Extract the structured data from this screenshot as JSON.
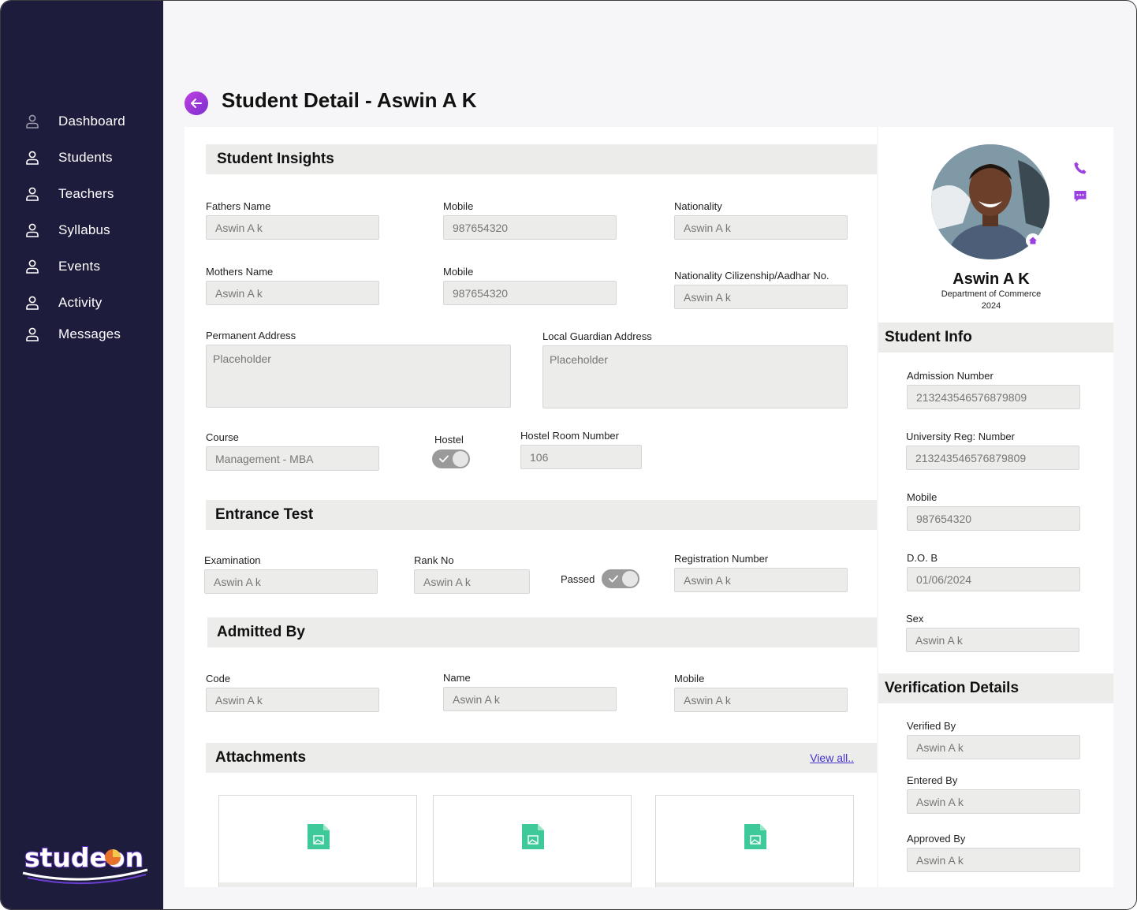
{
  "sidebar": {
    "items": [
      {
        "label": "Dashboard"
      },
      {
        "label": "Students"
      },
      {
        "label": "Teachers"
      },
      {
        "label": "Syllabus"
      },
      {
        "label": "Events"
      },
      {
        "label": "Activity"
      },
      {
        "label": "Messages"
      }
    ],
    "logo_text": "studeon"
  },
  "header": {
    "title": "Student Detail - Aswin A K"
  },
  "insights": {
    "title": "Student  Insights",
    "fathers_name": {
      "label": "Fathers Name",
      "value": "Aswin A k"
    },
    "fathers_mobile": {
      "label": "Mobile",
      "value": "987654320"
    },
    "nationality": {
      "label": "Nationality",
      "value": "Aswin A k"
    },
    "mothers_name": {
      "label": "Mothers Name",
      "value": "Aswin A k"
    },
    "mothers_mobile": {
      "label": "Mobile",
      "value": "987654320"
    },
    "citizenship": {
      "label": "Nationality Cilizenship/Aadhar No.",
      "value": "Aswin A k"
    },
    "permanent_address": {
      "label": "Permanent Address",
      "placeholder": "Placeholder"
    },
    "guardian_address": {
      "label": "Local Guardian Address",
      "placeholder": "Placeholder"
    },
    "course": {
      "label": "Course",
      "value": "Management - MBA"
    },
    "hostel": {
      "label": "Hostel",
      "on": true
    },
    "hostel_room": {
      "label": "Hostel Room Number",
      "value": "106"
    }
  },
  "entrance": {
    "title": "Entrance Test",
    "examination": {
      "label": "Examination",
      "value": "Aswin A k"
    },
    "rank": {
      "label": "Rank No",
      "value": "Aswin A k"
    },
    "passed": {
      "label": "Passed",
      "on": true
    },
    "registration": {
      "label": "Registration Number",
      "value": "Aswin A k"
    }
  },
  "admitted": {
    "title": "Admitted By",
    "code": {
      "label": "Code",
      "value": "Aswin A k"
    },
    "name": {
      "label": "Name",
      "value": "Aswin A k"
    },
    "mobile": {
      "label": "Mobile",
      "value": "Aswin A k"
    }
  },
  "attachments": {
    "title": "Attachments",
    "view_all": "View all.."
  },
  "profile": {
    "name": "Aswin A K",
    "department": "Department of Commerce",
    "year": "2024"
  },
  "student_info": {
    "title": "Student Info",
    "admission": {
      "label": "Admission Number",
      "value": "213243546576879809"
    },
    "university": {
      "label": "University Reg: Number",
      "value": "213243546576879809"
    },
    "mobile": {
      "label": "Mobile",
      "value": "987654320"
    },
    "dob": {
      "label": "D.O. B",
      "value": "01/06/2024"
    },
    "sex": {
      "label": "Sex",
      "value": "Aswin A k"
    }
  },
  "verification": {
    "title": "Verification Details",
    "verified_by": {
      "label": "Verified By",
      "value": "Aswin A k"
    },
    "entered_by": {
      "label": "Entered By",
      "value": "Aswin A k"
    },
    "approved_by": {
      "label": "Approved By",
      "value": "Aswin A k"
    }
  },
  "colors": {
    "sidebar_bg": "#1e1c3c",
    "accent": "#9b3fe0",
    "file_icon": "#3ec99a",
    "field_bg": "#ececeb"
  }
}
